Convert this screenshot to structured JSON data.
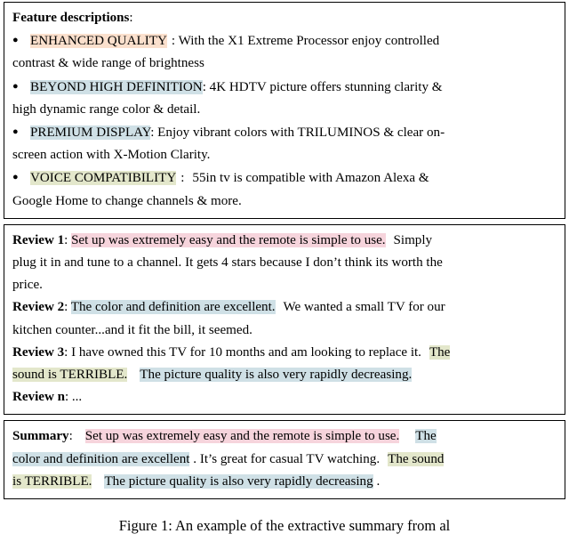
{
  "document": {
    "figure_caption": "Figure 1: An example of the extractive summary from al"
  },
  "colors": {
    "highlight_peach": "#fbe0cd",
    "highlight_blue": "#cfe0e6",
    "highlight_green": "#e3e7cb",
    "highlight_pink": "#f6d4dc",
    "border": "#000000",
    "text": "#000000"
  },
  "feature_box": {
    "heading": "Feature descriptions",
    "heading_colon": ":",
    "bullet_glyph": "●",
    "items": [
      {
        "tag": "ENHANCED QUALITY",
        "tag_highlight": "peach",
        "separator": ":",
        "body_line1": "With the X1 Extreme Processor enjoy controlled",
        "body_line2": "contrast & wide range of brightness"
      },
      {
        "tag": "BEYOND HIGH DEFINITION",
        "tag_highlight": "blue",
        "separator": ":",
        "body_line1": "4K HDTV picture offers stunning clarity &",
        "body_line2": "high dynamic range color & detail."
      },
      {
        "tag": "PREMIUM DISPLAY",
        "tag_highlight": "blue",
        "separator": ":",
        "body_line1": "Enjoy vibrant colors with TRILUMINOS & clear on-",
        "body_line2": "screen action with X-Motion Clarity."
      },
      {
        "tag": "VOICE COMPATIBILITY",
        "tag_highlight": "green",
        "separator": ":",
        "body_line1": "55in tv is compatible with Amazon Alexa &",
        "body_line2": "Google Home to change channels & more."
      }
    ]
  },
  "reviews_box": {
    "review1": {
      "label": "Review 1",
      "colon": ":",
      "hl_pink_1": "Set up was extremely easy and the remote is simple to use.",
      "plain_1": "Simply",
      "line2": "plug it in and tune to a channel. It gets 4 stars because I don’t think its worth the",
      "line3": "price."
    },
    "review2": {
      "label": "Review 2",
      "colon": ":",
      "hl_blue_1": "The color and definition are excellent.",
      "plain_1": "We wanted a small TV for our",
      "line2": "kitchen counter...and it fit the bill, it seemed."
    },
    "review3": {
      "label": "Review 3",
      "colon": ":",
      "plain_1": "I have owned this TV for 10 months and am looking to replace it.",
      "hl_green_1": "The",
      "hl_green_2": "sound is TERRIBLE.",
      "hl_blue_1": "The picture quality is also very rapidly decreasing."
    },
    "review_n": {
      "label": "Review n",
      "colon": ":",
      "text": "..."
    }
  },
  "summary_box": {
    "label": "Summary",
    "colon": ":",
    "hl_pink_1": "Set up was extremely easy and the remote is simple to use.",
    "hl_blue_1a": "The",
    "hl_blue_1b": "color and definition are excellent",
    "plain_1": ". It’s great for casual TV watching.",
    "hl_green_1a": "The sound",
    "hl_green_1b": "is TERRIBLE.",
    "hl_blue_2": "The picture quality is also very rapidly decreasing",
    "plain_end": "."
  }
}
